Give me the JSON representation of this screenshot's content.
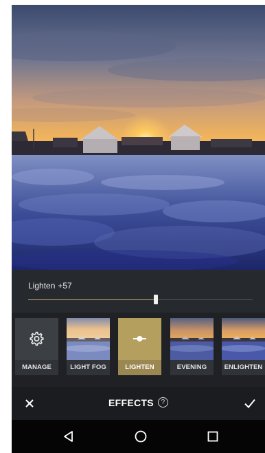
{
  "slider": {
    "label": "Lighten",
    "value_text": "+57",
    "fraction": 0.57
  },
  "effects": [
    {
      "label": "MANAGE",
      "icon": "gear-icon"
    },
    {
      "label": "LIGHT FOG"
    },
    {
      "label": "LIGHTEN",
      "icon": "lighten-slider-icon",
      "active": true
    },
    {
      "label": "EVENING"
    },
    {
      "label": "ENLIGHTEN"
    }
  ],
  "action_bar": {
    "title": "EFFECTS",
    "help_glyph": "?"
  },
  "nav": {
    "back": "back-icon",
    "home": "home-icon",
    "recents": "recents-icon"
  },
  "colors": {
    "accent": "#b59f5e",
    "background": "#1b1d20",
    "slider_fill": "#c9b36e"
  }
}
